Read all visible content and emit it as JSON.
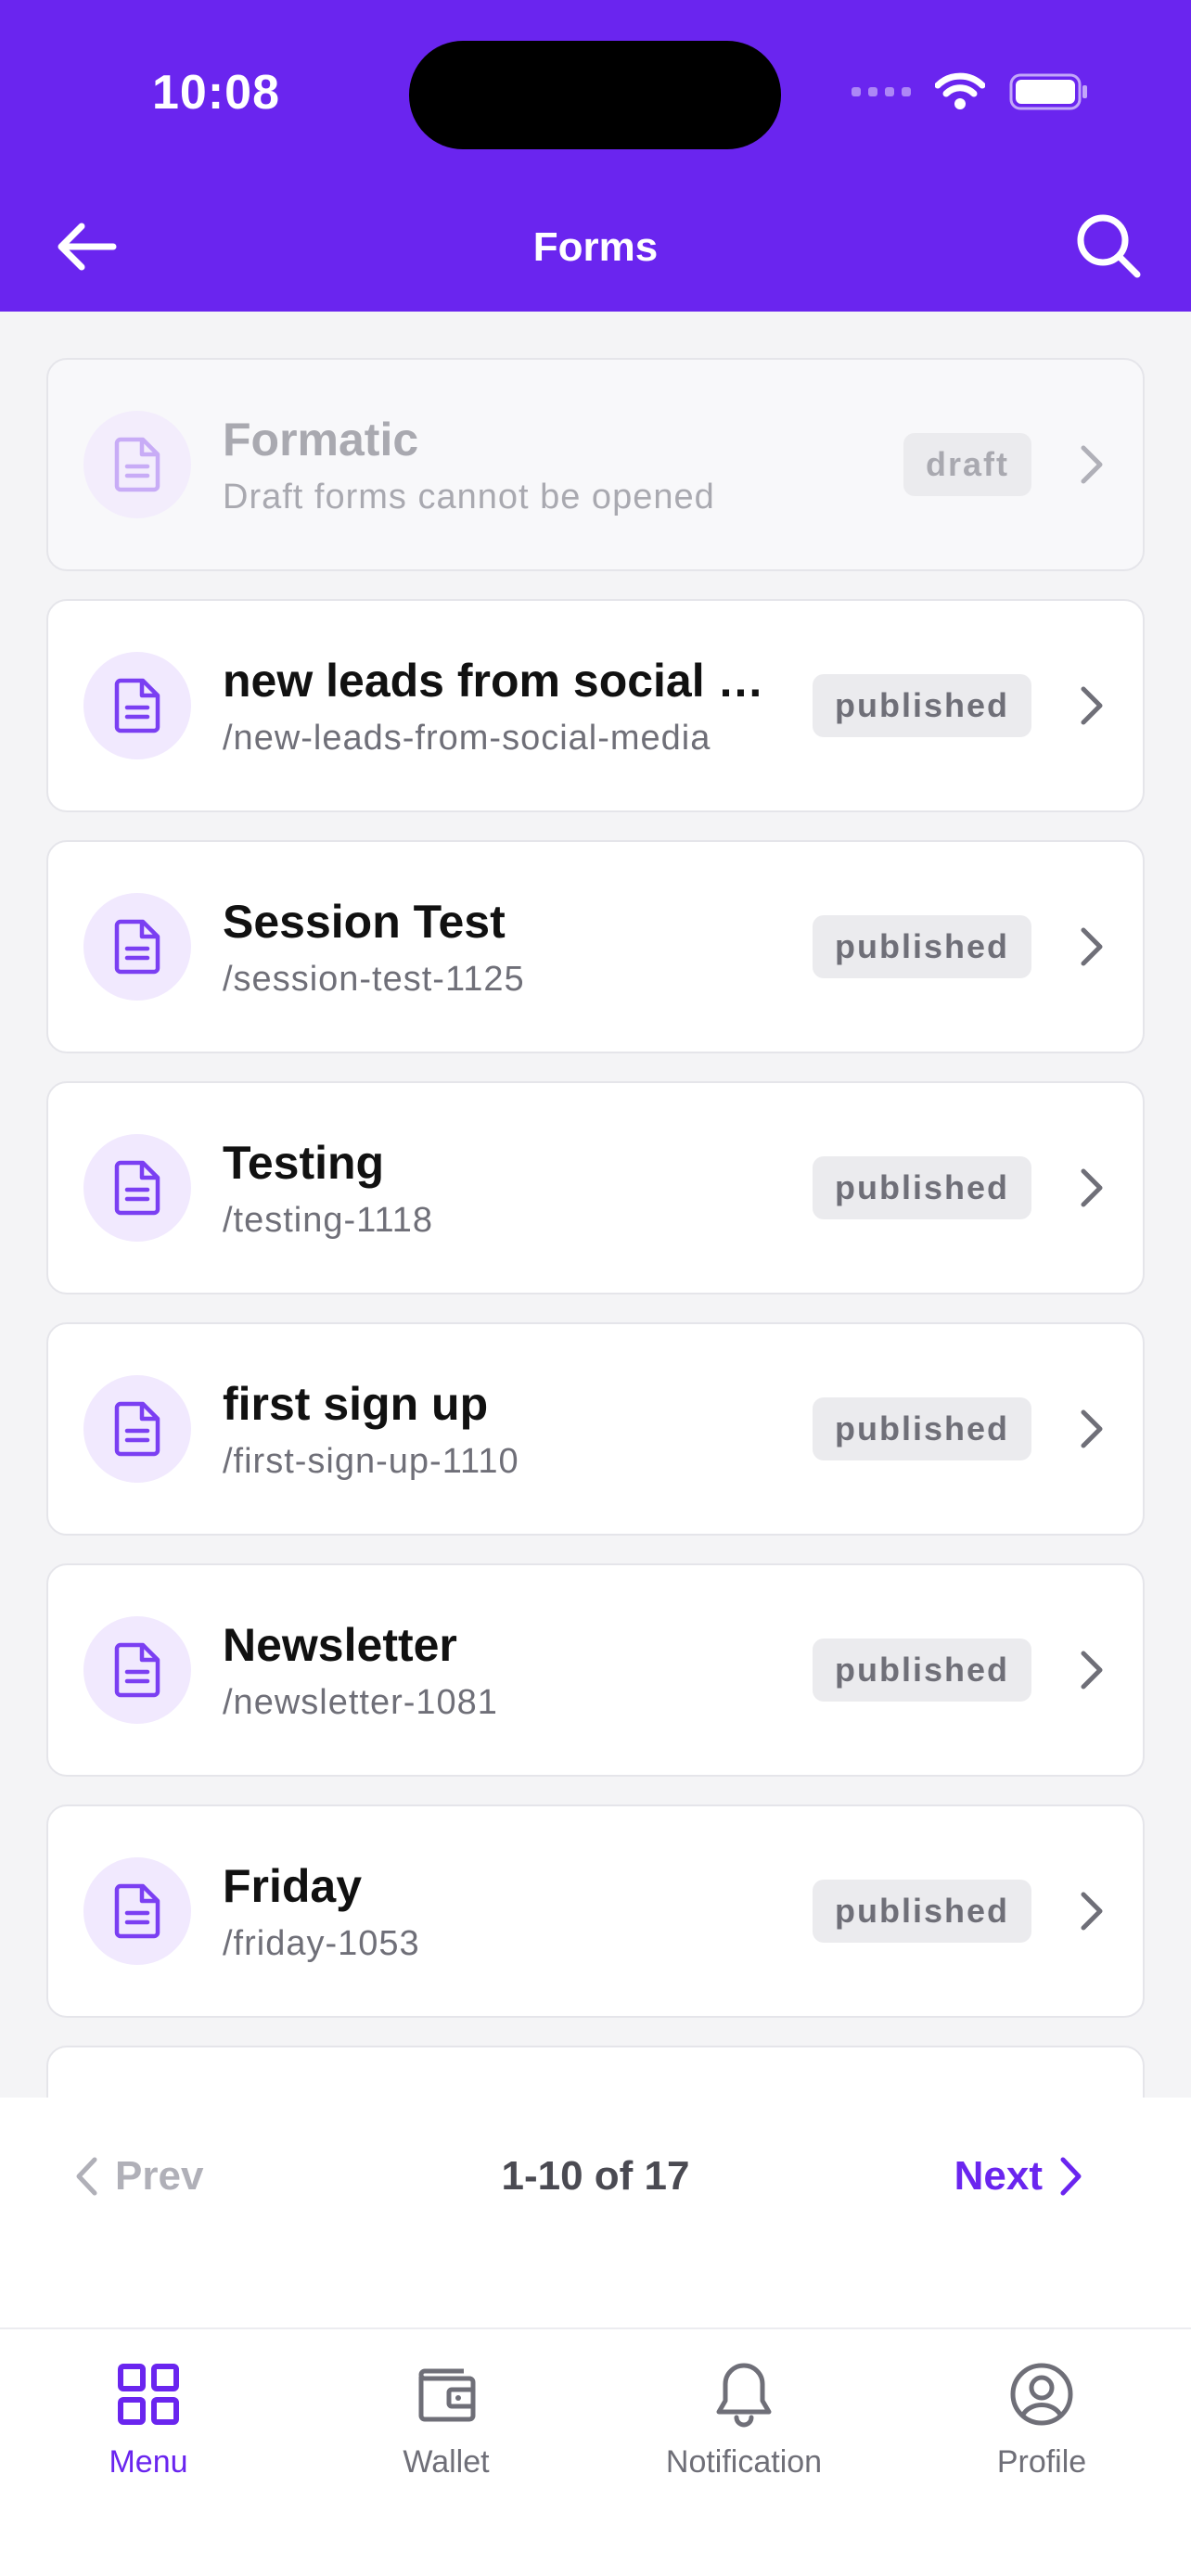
{
  "status_bar": {
    "time": "10:08"
  },
  "nav": {
    "title": "Forms",
    "back_icon": "arrow-left-icon",
    "search_icon": "search-icon"
  },
  "colors": {
    "brand": "#6a25ef",
    "icon_bg": "#f1e9fe",
    "badge_bg": "#ebebee"
  },
  "forms": [
    {
      "title": "Formatic",
      "subtitle": "Draft forms cannot be opened",
      "status": "draft"
    },
    {
      "title": "new leads from social media",
      "subtitle": "/new-leads-from-social-media",
      "status": "published"
    },
    {
      "title": "Session Test",
      "subtitle": "/session-test-1125",
      "status": "published"
    },
    {
      "title": "Testing",
      "subtitle": "/testing-1118",
      "status": "published"
    },
    {
      "title": "first sign up",
      "subtitle": "/first-sign-up-1110",
      "status": "published"
    },
    {
      "title": "Newsletter",
      "subtitle": "/newsletter-1081",
      "status": "published"
    },
    {
      "title": "Friday",
      "subtitle": "/friday-1053",
      "status": "published"
    }
  ],
  "pagination": {
    "prev_label": "Prev",
    "info": "1-10 of 17",
    "next_label": "Next"
  },
  "tabs": [
    {
      "label": "Menu",
      "icon": "grid-icon",
      "active": true
    },
    {
      "label": "Wallet",
      "icon": "wallet-icon",
      "active": false
    },
    {
      "label": "Notification",
      "icon": "bell-icon",
      "active": false
    },
    {
      "label": "Profile",
      "icon": "user-circle-icon",
      "active": false
    }
  ]
}
